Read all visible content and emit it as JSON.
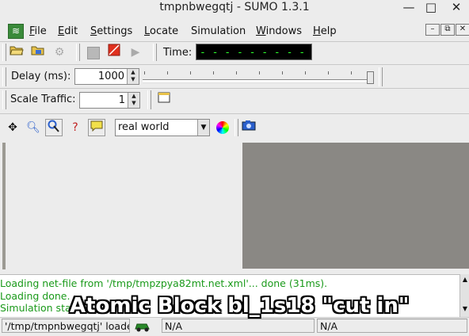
{
  "window": {
    "title": "tmpnbwegqtj - SUMO 1.3.1",
    "controls": {
      "minimize": "—",
      "maximize": "□",
      "close": "✕"
    }
  },
  "menubar": {
    "items": [
      {
        "first": "F",
        "rest": "ile"
      },
      {
        "first": "E",
        "rest": "dit"
      },
      {
        "first": "S",
        "rest": "ettings"
      },
      {
        "first": "L",
        "rest": "ocate"
      },
      {
        "first": "",
        "rest": "Simulation"
      },
      {
        "first": "W",
        "rest": "indows"
      },
      {
        "first": "H",
        "rest": "elp"
      }
    ],
    "mdi_controls": {
      "minimize": "–",
      "restore": "⧉",
      "close": "✕"
    }
  },
  "toolbar1": {
    "time_label": "Time:",
    "time_value": "- - - - - - - - - - - - - -"
  },
  "toolbar2": {
    "delay_label": "Delay (ms):",
    "delay_value": "1000",
    "delay_slider_fraction": 1.0
  },
  "toolbar3": {
    "scale_label": "Scale Traffic:",
    "scale_value": "1"
  },
  "view_toolbar": {
    "scheme_selected": "real world"
  },
  "messages": [
    "Loading net-file from '/tmp/tmpzpya82mt.net.xml'... done (31ms).",
    "Loading done.",
    "Simulation sta"
  ],
  "statusbar": {
    "path": "'/tmp/tmpnbwegqtj' loade",
    "coord1": "N/A",
    "coord2": "N/A"
  },
  "overlay": {
    "caption": "Atomic Block bl_1s18 \"cut in\""
  },
  "colors": {
    "message_green": "#1a9a1a",
    "time_green": "#2cff2c",
    "canvas_gray": "#8a8884"
  }
}
